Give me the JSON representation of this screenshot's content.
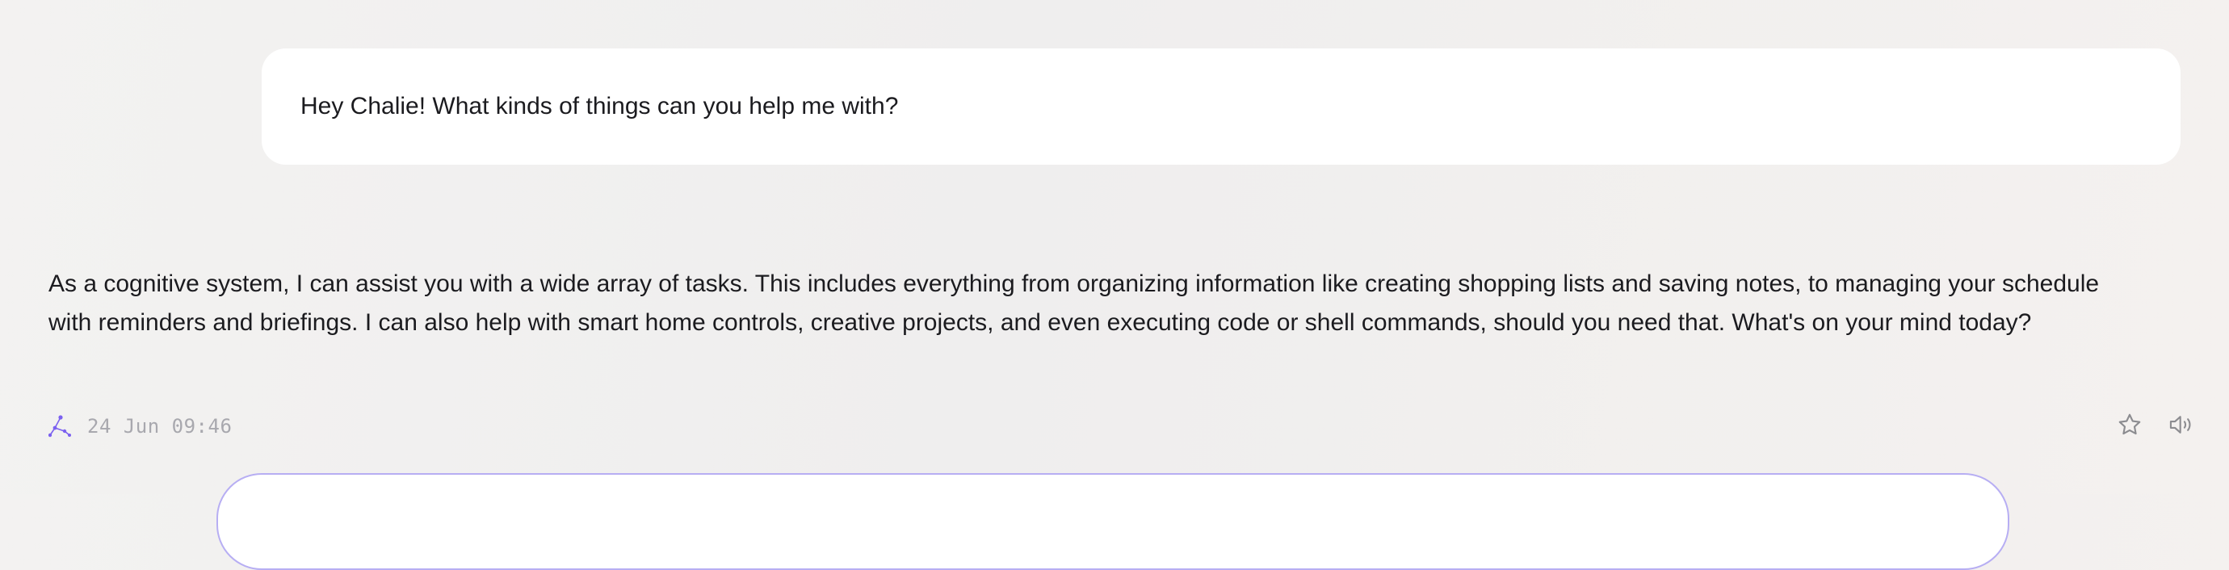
{
  "conversation": {
    "user_message": "Hey Chalie! What kinds of things can you help me with?",
    "assistant_message": "As a cognitive system, I can assist you with a wide array of tasks. This includes everything from organizing information like creating shopping lists and saving notes, to managing your schedule with reminders and briefings. I can also help with smart home controls, creative projects, and even executing code or shell commands, should you need that. What's on your mind today?",
    "assistant_timestamp": "24 Jun 09:46"
  },
  "icons": {
    "assistant_avatar": "constellation-logo-icon",
    "favorite": "star-icon",
    "read_aloud": "speaker-icon"
  },
  "colors": {
    "accent": "#7b61f0",
    "composer_border": "#b7aef3",
    "muted_text": "#a8a8ae",
    "icon_gray": "#8c8c90"
  }
}
